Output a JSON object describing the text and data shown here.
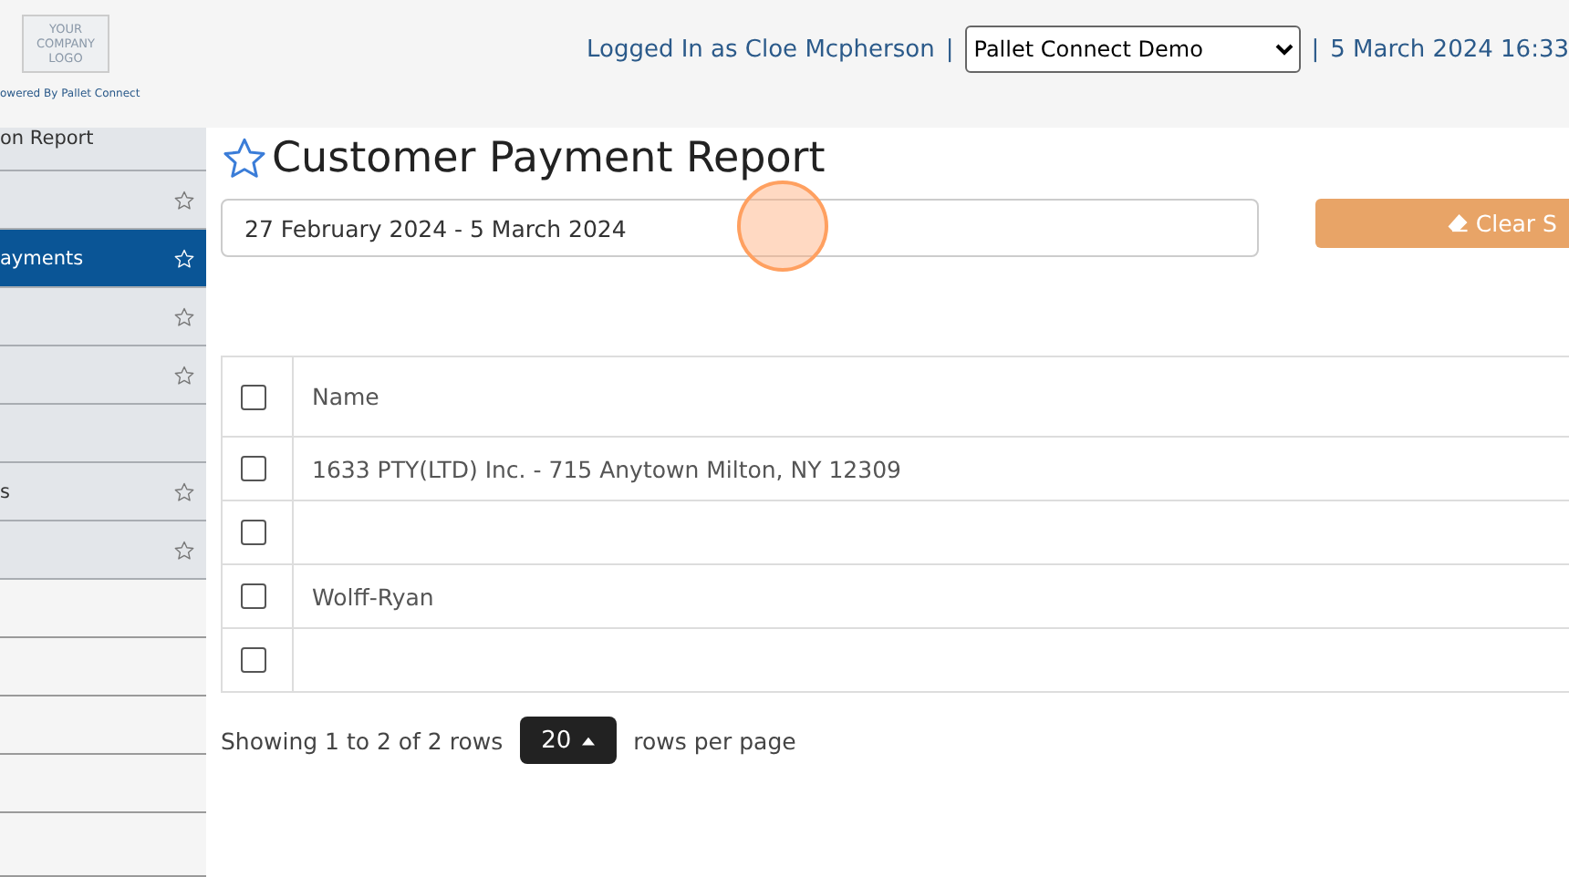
{
  "header": {
    "logo_lines": [
      "YOUR",
      "COMPANY",
      "LOGO"
    ],
    "powered_by": "owered By Pallet Connect",
    "logged_in": "Logged In as Cloe Mcpherson",
    "separator_1": "|",
    "company_select": "Pallet Connect Demo",
    "separator_2": "|",
    "datetime": "5 March 2024 16:33"
  },
  "sidebar": {
    "items": [
      {
        "label": "on Report",
        "starred": false,
        "selected": false,
        "kind": "menu"
      },
      {
        "starred": true,
        "selected": false,
        "kind": "menu"
      },
      {
        "label": "ayments",
        "starred": true,
        "selected": true,
        "kind": "menu"
      },
      {
        "starred": true,
        "selected": false,
        "kind": "menu"
      },
      {
        "starred": true,
        "selected": false,
        "kind": "menu"
      },
      {
        "starred": false,
        "selected": false,
        "kind": "menu"
      },
      {
        "label": "s",
        "starred": true,
        "selected": false,
        "kind": "menu"
      },
      {
        "starred": true,
        "selected": false,
        "kind": "menu"
      },
      {
        "selected": false,
        "kind": "plain"
      },
      {
        "selected": false,
        "kind": "plain"
      },
      {
        "selected": false,
        "kind": "plain"
      },
      {
        "selected": false,
        "kind": "plain"
      },
      {
        "selected": false,
        "kind": "plain"
      }
    ]
  },
  "page": {
    "title": "Customer Payment Report",
    "favorite": false,
    "date_range": "27 February 2024 - 5 March 2024",
    "clear_button": "Clear S"
  },
  "table": {
    "columns": [
      {
        "label": "Name",
        "checked": false
      }
    ],
    "rows": [
      {
        "name": "1633 PTY(LTD) Inc. - 715 Anytown Milton, NY 12309",
        "checked": false
      },
      {
        "checked": false
      },
      {
        "name": "Wolff-Ryan",
        "checked": false
      },
      {
        "checked": false
      }
    ]
  },
  "pagination": {
    "summary": "Showing 1 to 2 of 2 rows",
    "page_size": "20",
    "suffix": "rows per page"
  }
}
